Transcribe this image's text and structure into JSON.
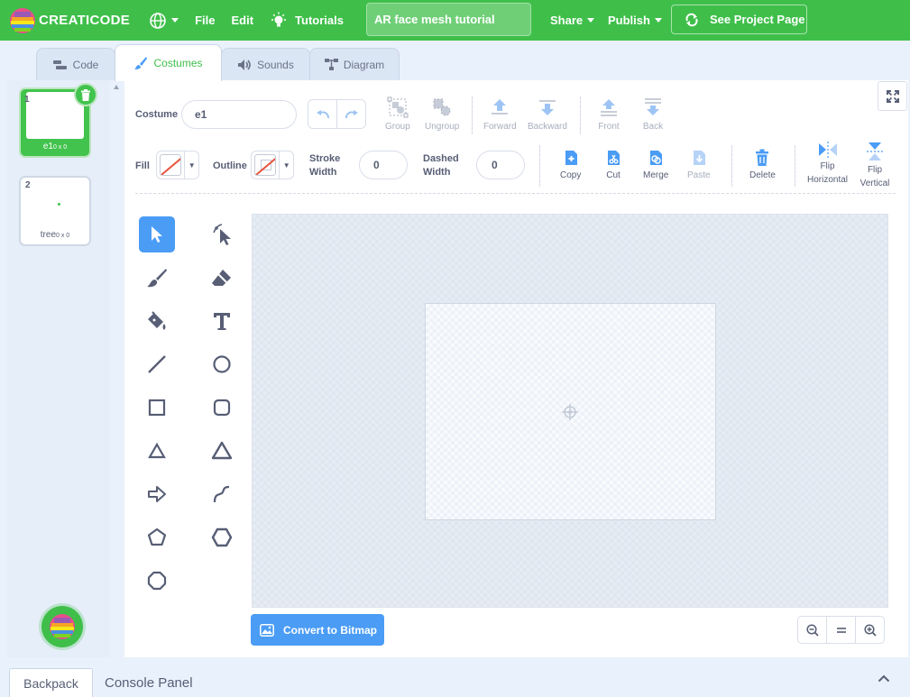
{
  "brand": {
    "name": "CREATICODE"
  },
  "menu": {
    "file": "File",
    "edit": "Edit",
    "tutorials": "Tutorials",
    "share": "Share",
    "publish": "Publish",
    "see_project": "See Project Page"
  },
  "project_title": "AR face mesh tutorial",
  "tabs": [
    {
      "label": "Code"
    },
    {
      "label": "Costumes"
    },
    {
      "label": "Sounds"
    },
    {
      "label": "Diagram"
    }
  ],
  "active_tab": "Costumes",
  "costumes": [
    {
      "index": "1",
      "name": "e1",
      "dims": "0 x 0",
      "selected": true
    },
    {
      "index": "2",
      "name": "tree",
      "dims": "0 x 0",
      "selected": false
    }
  ],
  "editor": {
    "costume_label": "Costume",
    "costume_name": "e1",
    "group": "Group",
    "ungroup": "Ungroup",
    "forward": "Forward",
    "backward": "Backward",
    "front": "Front",
    "back": "Back",
    "fill_label": "Fill",
    "outline_label": "Outline",
    "stroke_width_label": "Stroke Width",
    "stroke_width_value": "0",
    "dashed_width_label": "Dashed Width",
    "dashed_width_value": "0",
    "copy": "Copy",
    "cut": "Cut",
    "merge": "Merge",
    "paste": "Paste",
    "delete": "Delete",
    "flip_horizontal": "Flip Horizontal",
    "flip_vertical": "Flip Vertical",
    "convert_bitmap": "Convert to Bitmap"
  },
  "bottom": {
    "backpack": "Backpack",
    "console": "Console Panel"
  },
  "colors": {
    "brand_green": "#3fbf4a",
    "accent_blue": "#4a9cf5",
    "text": "#575e75",
    "no_color_red": "#e5533d"
  }
}
